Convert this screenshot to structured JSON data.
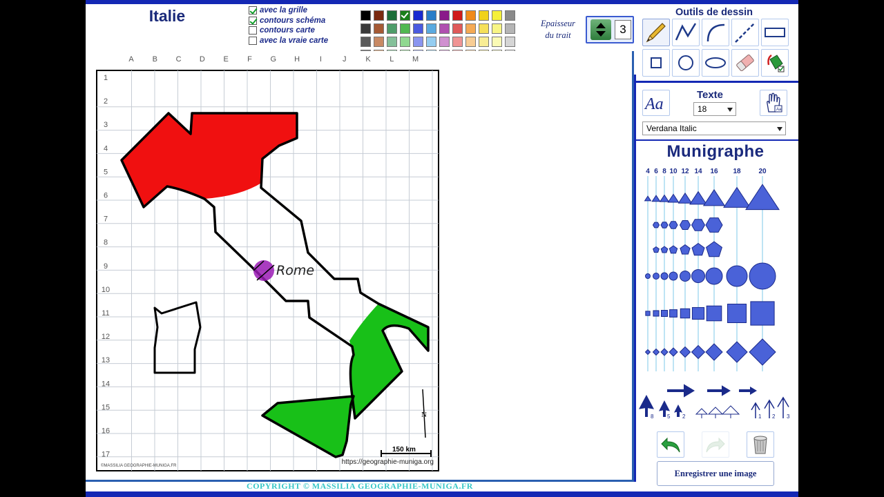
{
  "title": "Italie",
  "options": [
    {
      "label": "avec la grille",
      "checked": true
    },
    {
      "label": "contours schéma",
      "checked": true
    },
    {
      "label": "contours carte",
      "checked": false
    },
    {
      "label": "avec la vraie carte",
      "checked": false
    }
  ],
  "palette": [
    "#000000",
    "#7a2a10",
    "#1d6e3a",
    "#1a7f1a",
    "#1a2ad0",
    "#2a7dc8",
    "#8a1a8a",
    "#d01a1a",
    "#f08a1a",
    "#f0d21a",
    "#f5f03a",
    "#8a8a8a",
    "#3a3a3a",
    "#a55a35",
    "#4f9d6a",
    "#50b850",
    "#4a5ae0",
    "#5aaae0",
    "#b050b0",
    "#e05a5a",
    "#f5aa55",
    "#f5e05a",
    "#f8f585",
    "#b5b5b5",
    "#5a5a5a",
    "#c88a65",
    "#85c09a",
    "#90d890",
    "#8a95ef",
    "#95cdf0",
    "#d090d0",
    "#f09595",
    "#f8cd95",
    "#f8ed95",
    "#fafab5",
    "#d5d5d5",
    "#7a7a7a",
    "#e0b595",
    "#b5ddc0",
    "#c5eec5",
    "#c5ccf5",
    "#c8e8f8",
    "#e8c5e8",
    "#f8c8c8",
    "#fbe5c8",
    "#fbf5c8",
    "#fcfcdd",
    "#eeeeee"
  ],
  "selected_color_index": 3,
  "stroke": {
    "label_line1": "Epaisseur",
    "label_line2": "du trait",
    "value": "3"
  },
  "drawing_tools_title": "Outils de dessin",
  "drawing_tools": [
    "pencil-icon",
    "polyline-icon",
    "arc-icon",
    "dashed-line-icon",
    "rectangle-icon",
    "square-icon",
    "circle-icon",
    "ellipse-icon",
    "eraser-icon",
    "fill-bucket-icon"
  ],
  "text_tool": {
    "label": "Texte",
    "size": "18",
    "font": "Verdana Italic"
  },
  "munigraphe": {
    "title": "Munigraphe",
    "sizes": [
      "4",
      "6",
      "8",
      "10",
      "12",
      "14",
      "16",
      "18",
      "20"
    ]
  },
  "arrow_labels": [
    "8",
    "5",
    "2",
    "1",
    "2",
    "3"
  ],
  "save_label": "Enregistrer une image",
  "copyright": "COPYRIGHT © MASSILIA GEOGRAPHIE-MUNIGA.FR",
  "map": {
    "columns": [
      "A",
      "B",
      "C",
      "D",
      "E",
      "F",
      "G",
      "H",
      "I",
      "J",
      "K",
      "L",
      "M"
    ],
    "rows": [
      "1",
      "2",
      "3",
      "4",
      "5",
      "6",
      "7",
      "8",
      "9",
      "10",
      "11",
      "12",
      "13",
      "14",
      "15",
      "16",
      "17"
    ],
    "city_label": "Rome",
    "city_color": "#9a1bb5",
    "scale_label": "150 km",
    "compass_label": "N",
    "source_url": "https://geographie-muniga.org",
    "watermark": "©MASSILIA GEOGRAPHIE-MUNIGA.FR",
    "north_color": "#f01010",
    "south_color": "#18c018"
  }
}
